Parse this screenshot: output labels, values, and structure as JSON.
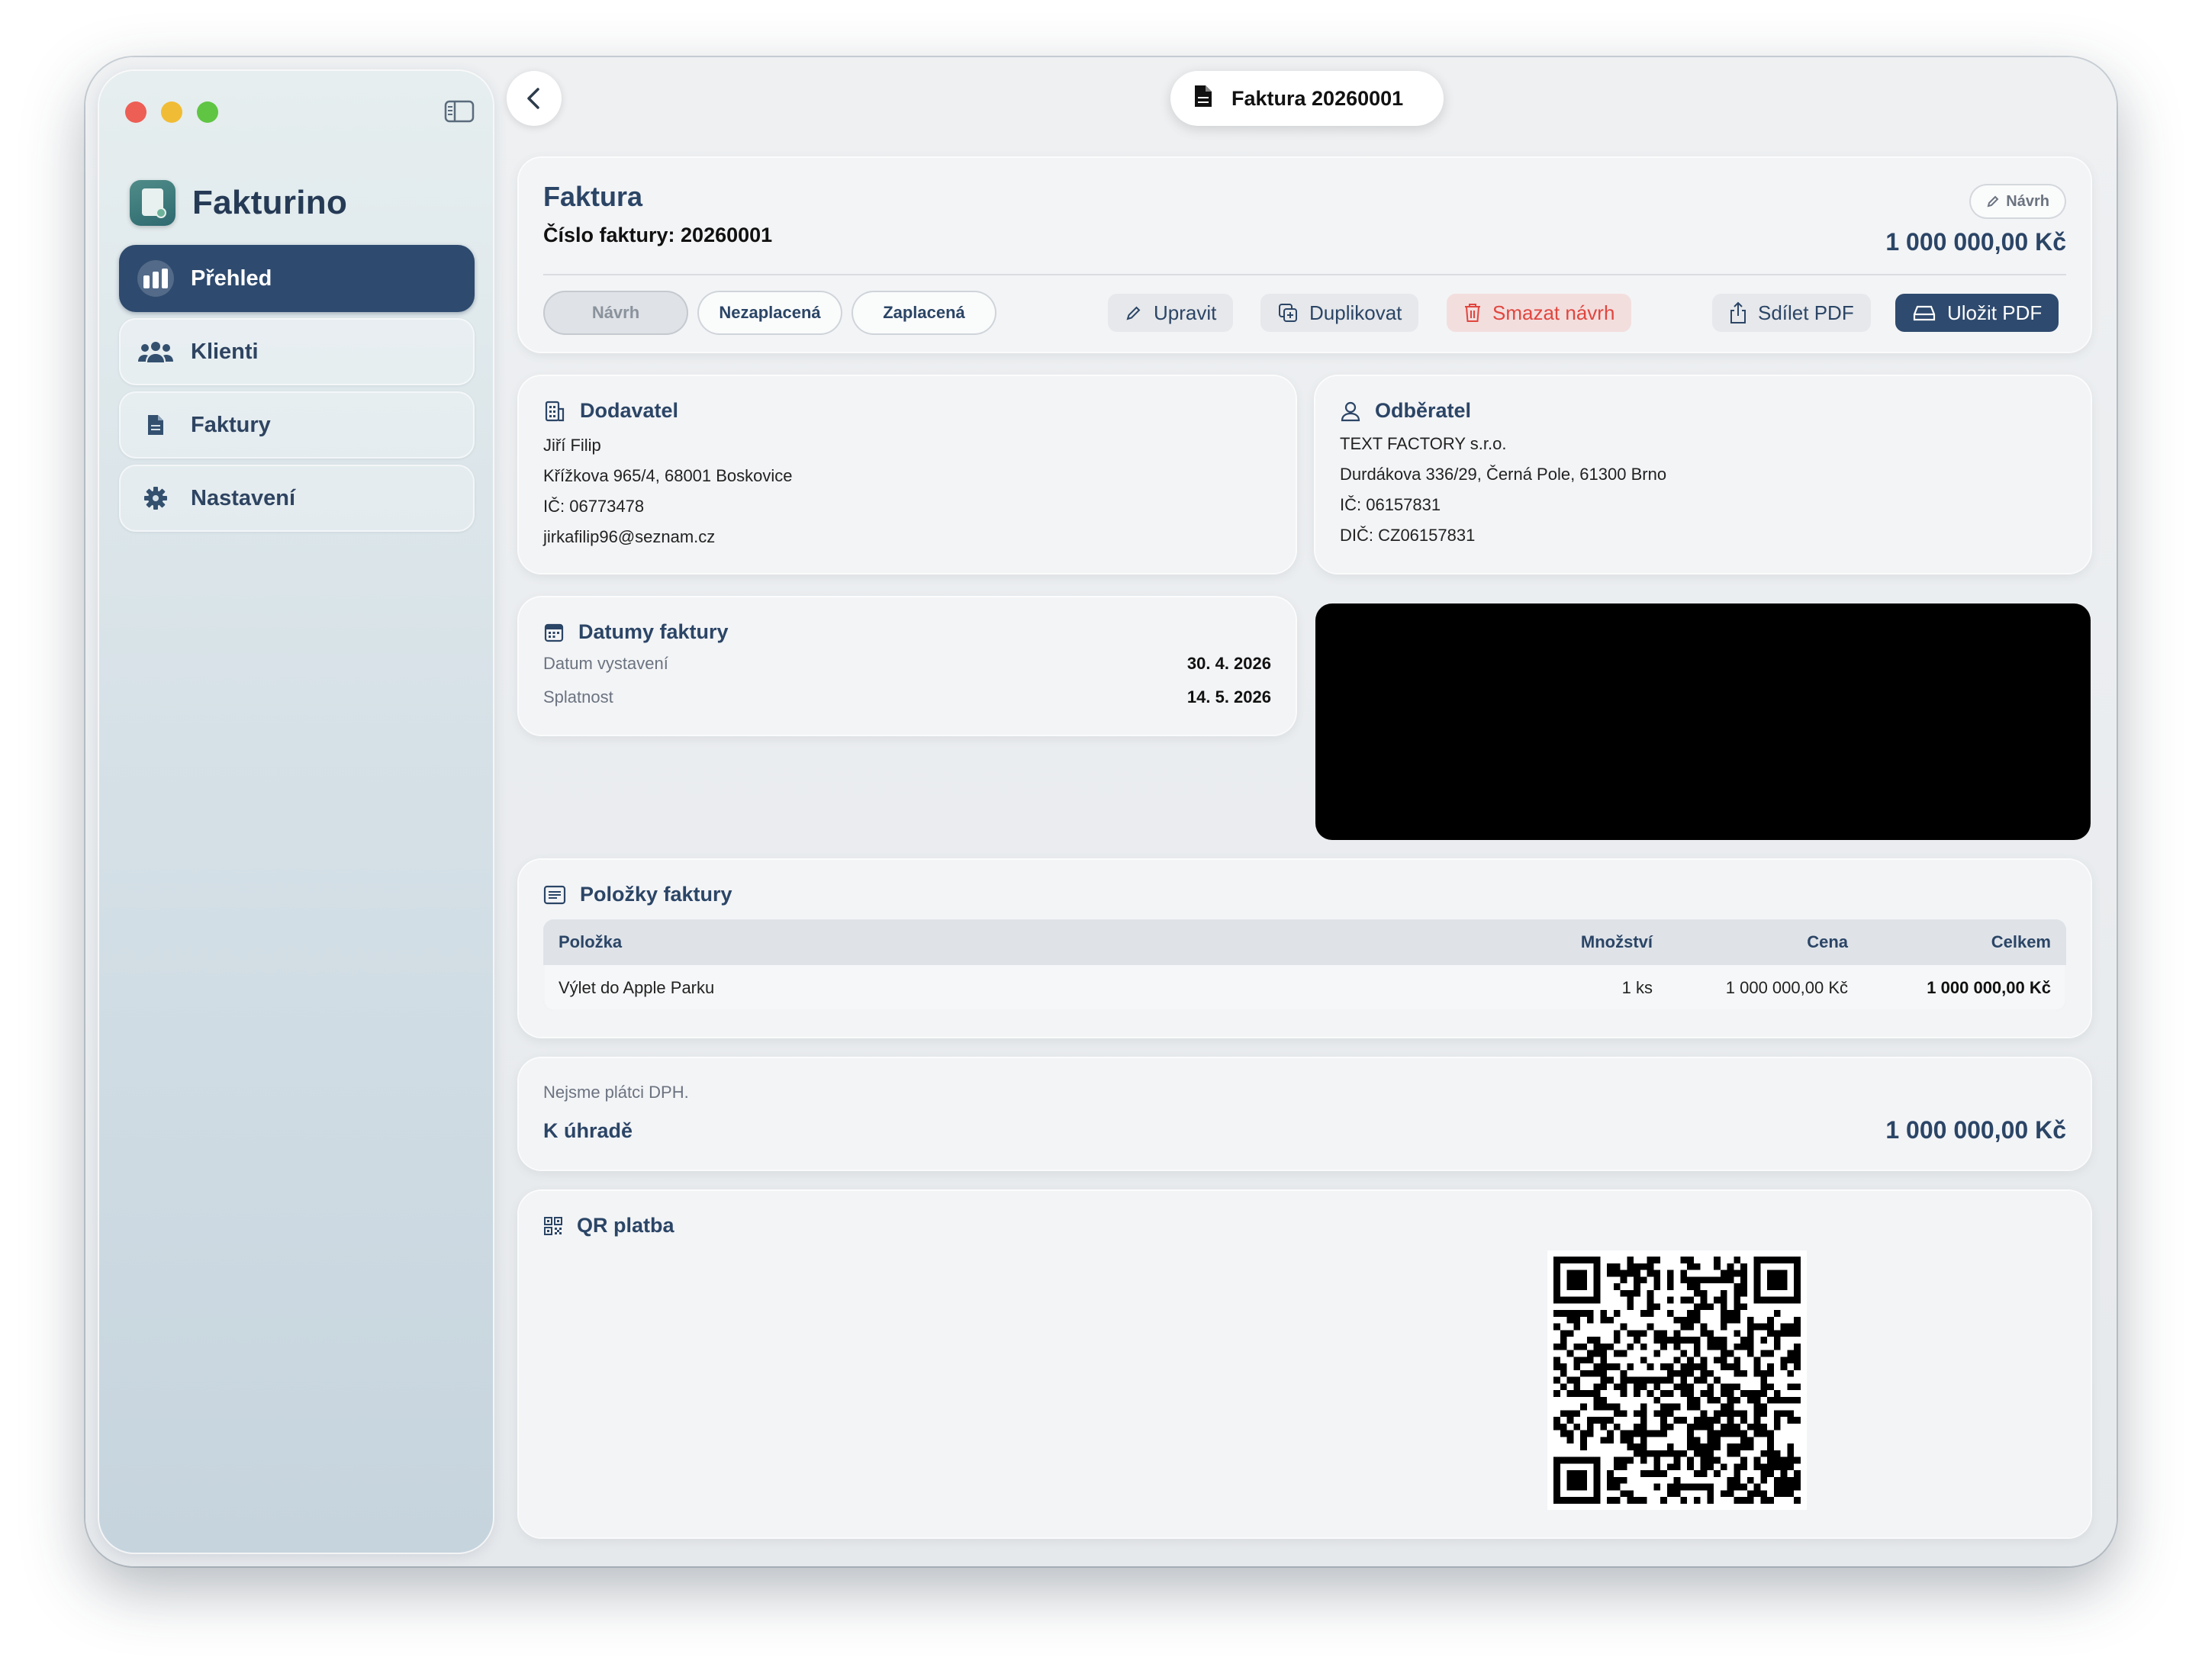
{
  "app": {
    "name": "Fakturino",
    "window_title": "Faktura 20260001"
  },
  "sidebar": {
    "items": [
      {
        "label": "Přehled",
        "icon": "chart-bar-icon",
        "active": true
      },
      {
        "label": "Klienti",
        "icon": "people-icon",
        "active": false
      },
      {
        "label": "Faktury",
        "icon": "document-icon",
        "active": false
      },
      {
        "label": "Nastavení",
        "icon": "gear-icon",
        "active": false
      }
    ]
  },
  "header": {
    "title": "Faktura",
    "number_label": "Číslo faktury: 20260001",
    "status_badge": "Návrh",
    "total": "1 000 000,00 Kč",
    "status_segments": [
      "Návrh",
      "Nezaplacená",
      "Zaplacená"
    ],
    "actions": {
      "edit": "Upravit",
      "duplicate": "Duplikovat",
      "delete": "Smazat návrh",
      "share": "Sdílet PDF",
      "save": "Uložit PDF"
    }
  },
  "supplier": {
    "title": "Dodavatel",
    "lines": [
      "Jiří Filip",
      "Křížkova 965/4, 68001 Boskovice",
      "IČ: 06773478",
      "jirkafilip96@seznam.cz"
    ]
  },
  "customer": {
    "title": "Odběratel",
    "lines": [
      "TEXT FACTORY s.r.o.",
      "Durdákova 336/29, Černá Pole, 61300 Brno",
      "IČ: 06157831",
      "DIČ: CZ06157831"
    ]
  },
  "dates": {
    "title": "Datumy faktury",
    "issue_label": "Datum vystavení",
    "issue_value": "30. 4. 2026",
    "due_label": "Splatnost",
    "due_value": "14. 5. 2026"
  },
  "items": {
    "title": "Položky faktury",
    "columns": [
      "Položka",
      "Množství",
      "Cena",
      "Celkem"
    ],
    "rows": [
      {
        "name": "Výlet do Apple Parku",
        "qty": "1 ks",
        "price": "1 000 000,00 Kč",
        "total": "1 000 000,00 Kč"
      }
    ]
  },
  "summary": {
    "vat_note": "Nejsme plátci DPH.",
    "label": "K úhradě",
    "amount": "1 000 000,00 Kč"
  },
  "qr": {
    "title": "QR platba"
  },
  "colors": {
    "accent": "#2e4a6e",
    "danger": "#e0463e",
    "text_primary": "#2b4566"
  }
}
